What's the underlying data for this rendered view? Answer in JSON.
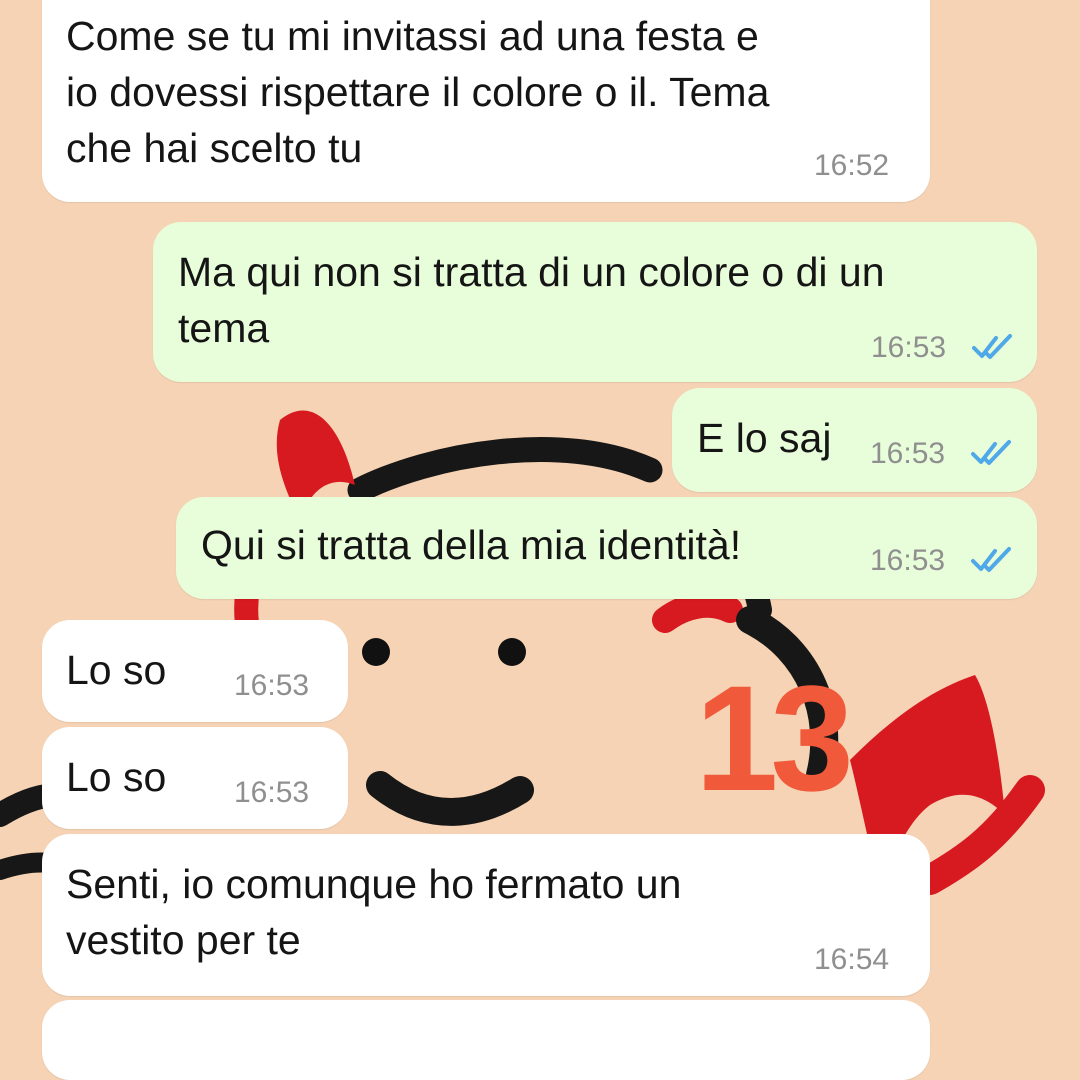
{
  "colors": {
    "wallpaper": "#f6d3b4",
    "incoming_bubble": "#ffffff",
    "outgoing_bubble": "#e8fdd9",
    "read_ticks": "#4fa8e8",
    "counter": "#f05a3a"
  },
  "messages": [
    {
      "direction": "incoming",
      "text": "Come se tu mi invitassi ad una festa e\nio dovessi rispettare il colore o il. Tema\nche hai scelto tu",
      "time": "16:52"
    },
    {
      "direction": "outgoing",
      "text": "Ma qui non si tratta di un colore o di un\ntema",
      "time": "16:53",
      "status": "read"
    },
    {
      "direction": "outgoing",
      "text": "E lo saj",
      "time": "16:53",
      "status": "read"
    },
    {
      "direction": "outgoing",
      "text": "Qui si tratta della mia identità!",
      "time": "16:53",
      "status": "read"
    },
    {
      "direction": "incoming",
      "text": "Lo so",
      "time": "16:53"
    },
    {
      "direction": "incoming",
      "text": "Lo so",
      "time": "16:53"
    },
    {
      "direction": "incoming",
      "text": "Senti, io comunque ho fermato un\nvestito per te",
      "time": "16:54"
    }
  ],
  "overlay": {
    "number": "13"
  }
}
